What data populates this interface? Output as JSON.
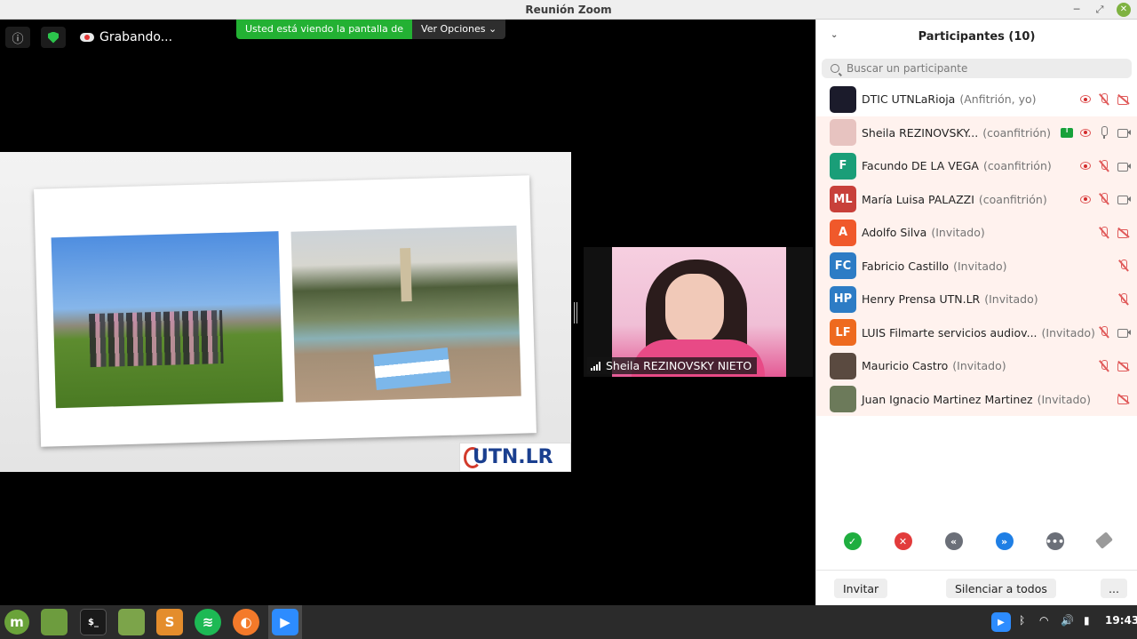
{
  "window": {
    "title": "Reunión Zoom"
  },
  "meeting_toolbar": {
    "recording_label": "Grabando..."
  },
  "share_banner": {
    "viewing_text": "Usted está viendo la pantalla de",
    "options_label": "Ver Opciones"
  },
  "shared_content": {
    "logo_text": "UTN.LR"
  },
  "video_tile": {
    "name": "Sheila REZINOVSKY NIETO"
  },
  "participants_panel": {
    "title": "Participantes (10)",
    "search_placeholder": "Buscar un participante",
    "participants": [
      {
        "initials": "",
        "avatar_color": "#1b1b2b",
        "name": "DTIC UTNLaRioja",
        "role": "(Anfitrión, yo)",
        "recording": true,
        "screen_share": false,
        "mic": "off",
        "video": "off"
      },
      {
        "initials": "",
        "avatar_color": "#e7c3c0",
        "name": "Sheila REZINOVSKY...",
        "role": "(coanfitrión)",
        "recording": true,
        "screen_share": true,
        "mic": "on",
        "video": "on"
      },
      {
        "initials": "F",
        "avatar_color": "#1a9e78",
        "name": "Facundo DE LA VEGA",
        "role": "(coanfitrión)",
        "recording": true,
        "screen_share": false,
        "mic": "off",
        "video": "on"
      },
      {
        "initials": "ML",
        "avatar_color": "#c8403a",
        "name": "María Luisa PALAZZI",
        "role": "(coanfitrión)",
        "recording": true,
        "screen_share": false,
        "mic": "off",
        "video": "on"
      },
      {
        "initials": "A",
        "avatar_color": "#f0592b",
        "name": "Adolfo Silva",
        "role": "(Invitado)",
        "recording": false,
        "screen_share": false,
        "mic": "off",
        "video": "off"
      },
      {
        "initials": "FC",
        "avatar_color": "#2d7cc5",
        "name": "Fabricio Castillo",
        "role": "(Invitado)",
        "recording": false,
        "screen_share": false,
        "mic": "off",
        "video": "none"
      },
      {
        "initials": "HP",
        "avatar_color": "#2d7cc5",
        "name": "Henry Prensa UTN.LR",
        "role": "(Invitado)",
        "recording": false,
        "screen_share": false,
        "mic": "off",
        "video": "none"
      },
      {
        "initials": "LF",
        "avatar_color": "#ee6a1f",
        "name": "LUIS Filmarte servicios audiov...",
        "role": "(Invitado)",
        "recording": false,
        "screen_share": false,
        "mic": "off",
        "video": "on"
      },
      {
        "initials": "",
        "avatar_color": "#5a4a40",
        "name": "Mauricio Castro",
        "role": "(Invitado)",
        "recording": false,
        "screen_share": false,
        "mic": "off",
        "video": "off"
      },
      {
        "initials": "",
        "avatar_color": "#6c7a5a",
        "name": "Juan Ignacio Martinez Martinez",
        "role": "(Invitado)",
        "recording": false,
        "screen_share": false,
        "mic": "none",
        "video": "off"
      }
    ],
    "reactions": [
      {
        "icon": "check-icon",
        "glyph": "✓",
        "color": "#1fae3f"
      },
      {
        "icon": "x-icon",
        "glyph": "✕",
        "color": "#e23b3b"
      },
      {
        "icon": "slower-icon",
        "glyph": "«",
        "color": "#6b6f78"
      },
      {
        "icon": "faster-icon",
        "glyph": "»",
        "color": "#1f7fe5"
      },
      {
        "icon": "more-icon",
        "glyph": "•••",
        "color": "#6b6f78"
      }
    ],
    "footer": {
      "invite_label": "Invitar",
      "mute_all_label": "Silenciar a todos",
      "more_label": "..."
    }
  },
  "taskbar": {
    "apps": [
      "mint-menu-icon",
      "desktop-icon",
      "terminal-icon",
      "files-icon",
      "sublime-icon",
      "spotify-icon",
      "firefox-icon",
      "zoom-icon"
    ],
    "clock": "19:43"
  }
}
